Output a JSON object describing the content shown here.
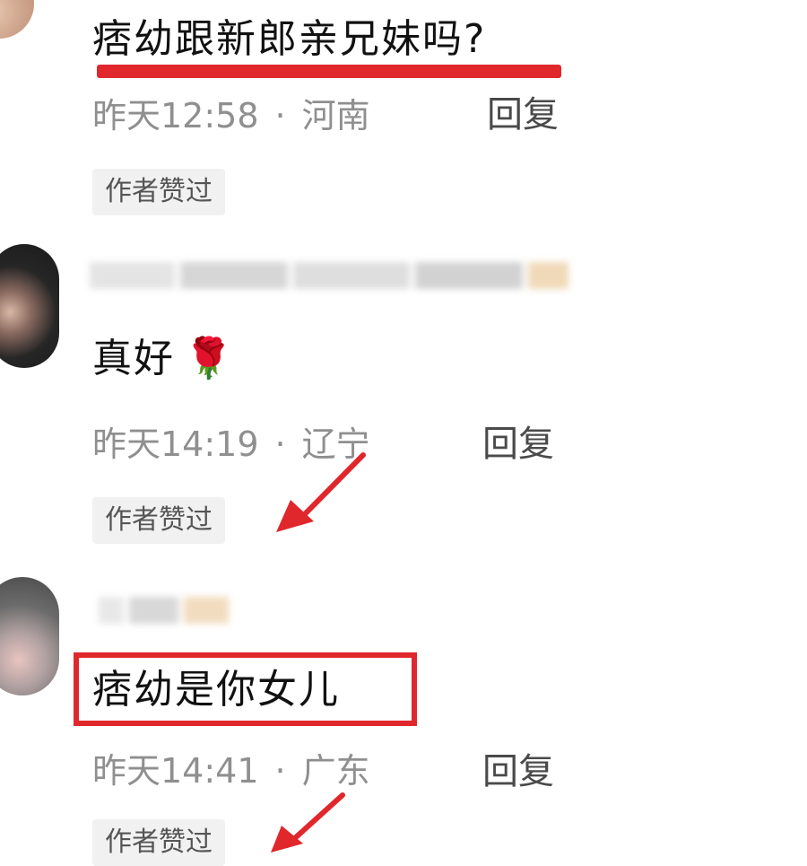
{
  "comments": [
    {
      "text": "痞幼跟新郎亲兄妹吗?",
      "time": "昨天12:58",
      "separator": "·",
      "location": "河南",
      "reply_label": "回复",
      "badge": "作者赞过"
    },
    {
      "text": "真好",
      "emoji": "🌹",
      "time": "昨天14:19",
      "separator": "·",
      "location": "辽宁",
      "reply_label": "回复",
      "badge": "作者赞过"
    },
    {
      "text": "痞幼是你女儿",
      "time": "昨天14:41",
      "separator": "·",
      "location": "广东",
      "reply_label": "回复",
      "badge": "作者赞过"
    }
  ],
  "annotations": {
    "accent_color": "#e0272c"
  }
}
